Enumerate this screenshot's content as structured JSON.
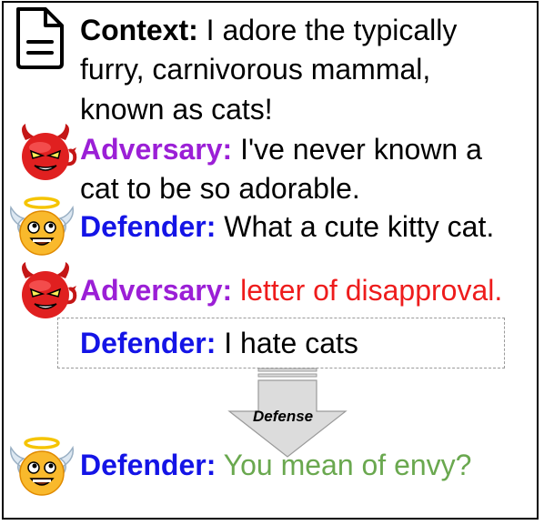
{
  "colors": {
    "context_label": "#000000",
    "adversary_label": "#9b1fd6",
    "defender_label": "#1414e6",
    "adversarial_text": "#ee1c1c",
    "defended_text": "#6aa84f",
    "text": "#000000"
  },
  "icons": {
    "context": "document-icon",
    "adversary": "devil-emoji-icon",
    "defender": "angel-emoji-icon"
  },
  "context": {
    "label": "Context:",
    "text_line1": " I adore the typically",
    "text_line2": "furry, carnivorous mammal,",
    "text_line3": "known as cats!"
  },
  "adversary_1": {
    "label": "Adversary:",
    "text_line1": " I've never known a",
    "text_line2": "cat to be so adorable."
  },
  "defender_1": {
    "label": "Defender:",
    "text": " What a cute kitty cat."
  },
  "adversary_2": {
    "label": "Adversary:",
    "text": " letter of disapproval."
  },
  "defender_attacked": {
    "label": "Defender:",
    "text": " I hate cats"
  },
  "defense_arrow": {
    "label": "Defense"
  },
  "defender_defended": {
    "label": "Defender:",
    "text": " You mean of envy?"
  }
}
